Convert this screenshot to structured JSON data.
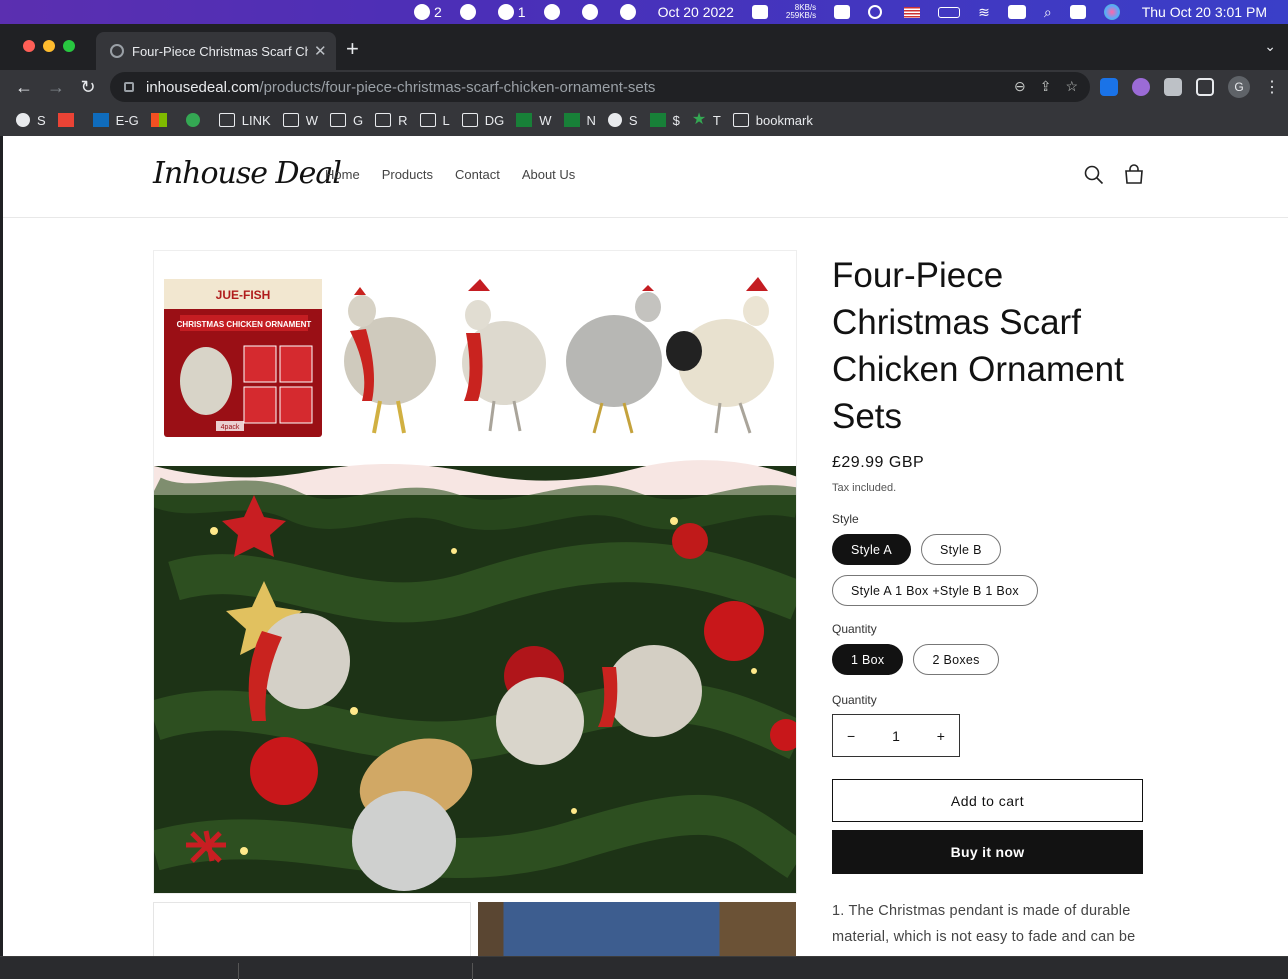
{
  "menubar": {
    "notif_count": "2",
    "wechat_count": "1",
    "date_short": "Oct 20 2022",
    "net_up": "8KB/s",
    "net_down": "259KB/s",
    "clock": "Thu Oct 20  3:01 PM"
  },
  "browser": {
    "tab_title": "Four-Piece Christmas Scarf Chicken Ornament Sets",
    "url_host": "inhousedeal.com",
    "url_path": "/products/four-piece-christmas-scarf-chicken-ornament-sets",
    "profile_initial": "G",
    "bookmarks": [
      "S",
      "E-G",
      "LINK",
      "W",
      "G",
      "R",
      "L",
      "DG",
      "W",
      "N",
      "S",
      "$",
      "T",
      "bookmark"
    ]
  },
  "site": {
    "logo": "Inhouse Deal",
    "nav": [
      "Home",
      "Products",
      "Contact",
      "About Us"
    ]
  },
  "product": {
    "title": "Four-Piece Christmas Scarf Chicken Ornament Sets",
    "price": "£29.99 GBP",
    "tax_note": "Tax included.",
    "style_label": "Style",
    "styles": [
      "Style A",
      "Style B",
      "Style A 1 Box +Style B 1 Box"
    ],
    "selected_style": "Style A",
    "pack_label": "Quantity",
    "packs": [
      "1 Box",
      "2 Boxes"
    ],
    "selected_pack": "1 Box",
    "qty_label": "Quantity",
    "qty_value": "1",
    "qty_minus": "−",
    "qty_plus": "+",
    "add_to_cart": "Add to cart",
    "buy_now": "Buy it now",
    "description": "1. The Christmas pendant is made of durable material, which is not easy to fade and can be",
    "box_brand": "JUE-FISH",
    "box_title": "CHRISTMAS CHICKEN ORNAMENT",
    "box_pack": "4pack"
  }
}
